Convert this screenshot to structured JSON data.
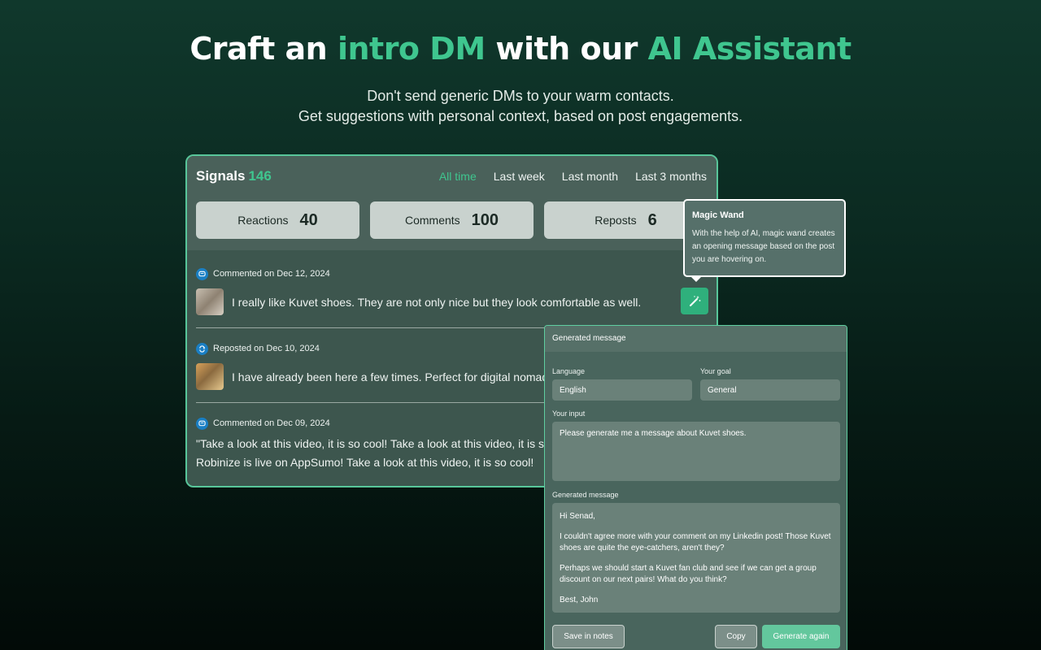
{
  "hero": {
    "title_part1": "Craft an ",
    "title_accent1": "intro DM",
    "title_part2": " with our ",
    "title_accent2": "AI Assistant",
    "subtitle_line1": "Don't send generic DMs to your warm contacts.",
    "subtitle_line2": "Get suggestions with personal context, based on post engagements."
  },
  "signals": {
    "title": "Signals",
    "count": "146",
    "periods": [
      {
        "label": "All time",
        "active": true
      },
      {
        "label": "Last week",
        "active": false
      },
      {
        "label": "Last month",
        "active": false
      },
      {
        "label": "Last 3 months",
        "active": false
      }
    ],
    "stats": [
      {
        "label": "Reactions",
        "value": "40"
      },
      {
        "label": "Comments",
        "value": "100"
      },
      {
        "label": "Reposts",
        "value": "6"
      }
    ],
    "posts": [
      {
        "meta": "Commented on Dec 12, 2024",
        "text": "I really like Kuvet shoes. They are not only nice but they look comfortable as well."
      },
      {
        "meta": "Reposted on Dec 10, 2024",
        "text": "I have already been here a few times. Perfect for digital nomads"
      },
      {
        "meta": "Commented on Dec 09, 2024",
        "line1": "\"Take a look at this video, it is so cool! Take a look at this video, it is so",
        "line2": "Robinize is live on AppSumo! Take a look at this video, it is so cool!"
      }
    ]
  },
  "tooltip": {
    "title": "Magic Wand",
    "text": "With the help of AI, magic wand creates an opening message based on the post you are hovering on."
  },
  "generator": {
    "header": "Generated message",
    "language_label": "Language",
    "language_value": "English",
    "goal_label": "Your goal",
    "goal_value": "General",
    "input_label": "Your input",
    "input_value": "Please generate me a message about Kuvet shoes.",
    "output_label": "Generated message",
    "output_paragraphs": [
      "Hi Senad,",
      "I couldn't agree more with your comment on my Linkedin post!  Those Kuvet shoes are quite the eye-catchers, aren't they?",
      "Perhaps we should start a Kuvet fan club and see if we can get a group discount on our next pairs! What do you think?",
      "Best, John"
    ],
    "save_label": "Save in notes",
    "copy_label": "Copy",
    "regenerate_label": "Generate again"
  }
}
